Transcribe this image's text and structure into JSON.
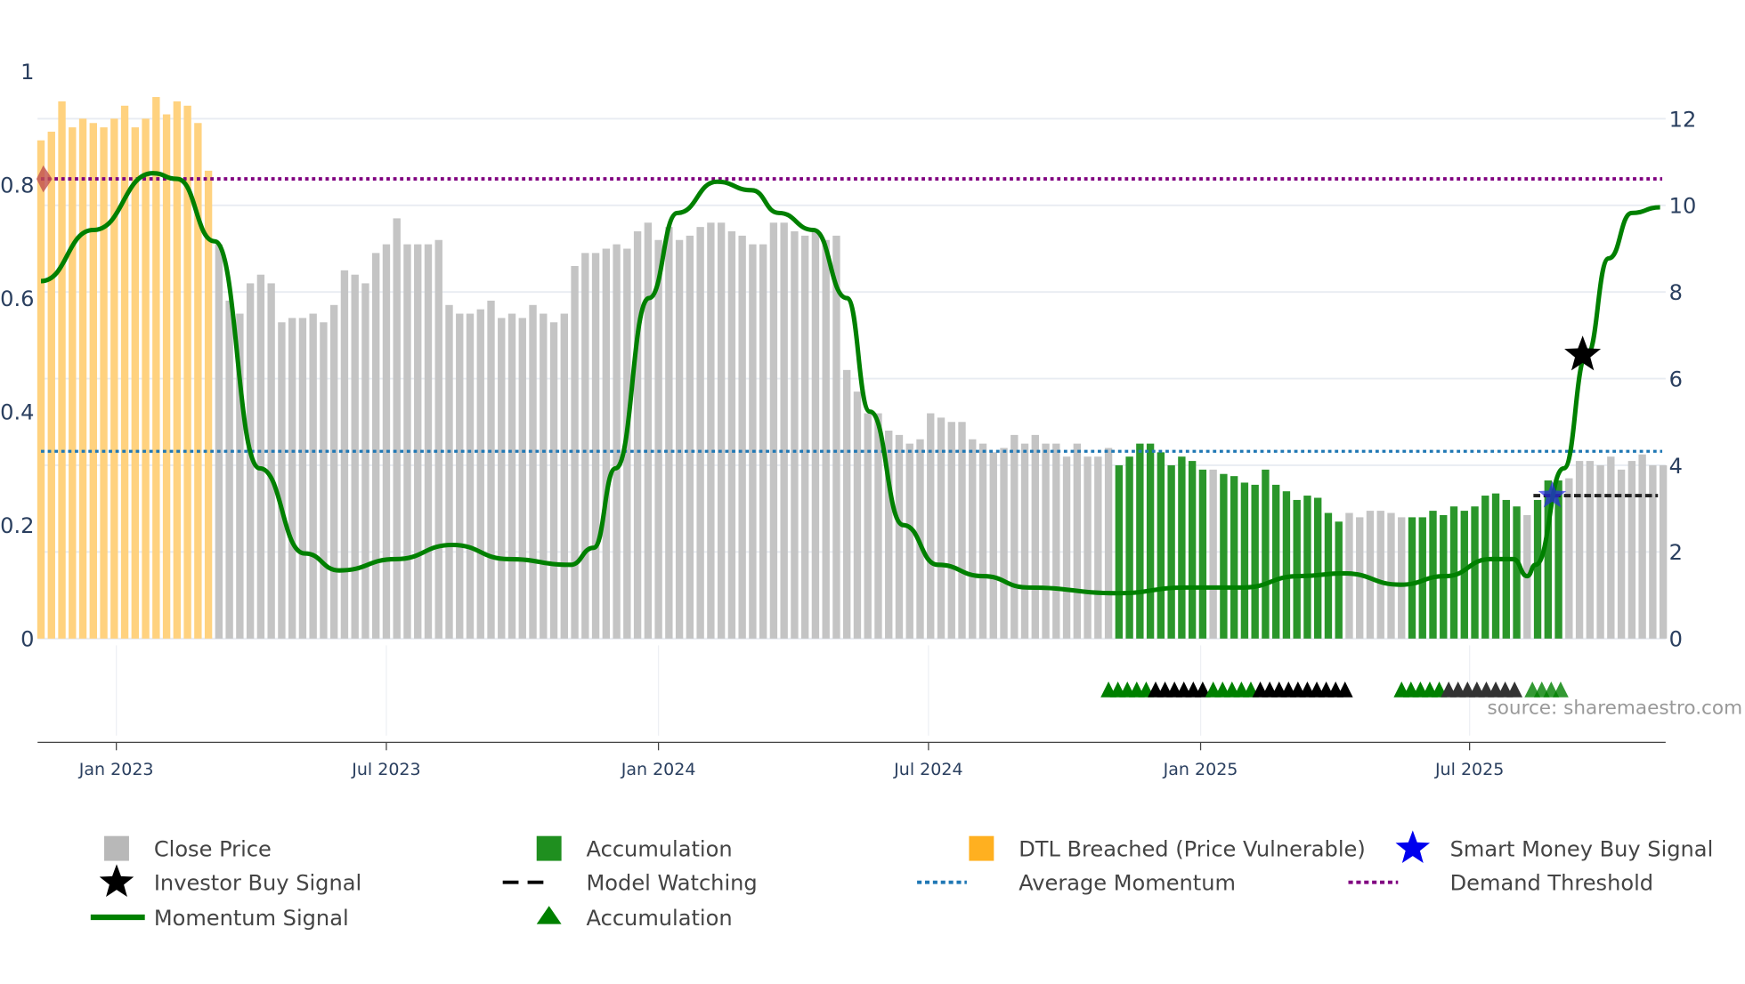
{
  "chart_data": {
    "type": "bar",
    "title": "",
    "x_unit": "week index (weekly bars)",
    "left_axis": {
      "ticks": [
        0,
        0.2,
        0.4,
        0.6,
        0.8,
        1
      ],
      "labels": [
        "0",
        "0.2",
        "0.4",
        "0.6",
        "0.8",
        "1"
      ],
      "range": [
        0,
        1
      ]
    },
    "right_axis": {
      "ticks": [
        0,
        2,
        4,
        6,
        8,
        10,
        12
      ],
      "labels": [
        "0",
        "2",
        "4",
        "6",
        "8",
        "10",
        "12"
      ],
      "range": [
        0,
        13.1
      ]
    },
    "x_ticks": [
      {
        "label": "Jan 2023",
        "x": 7.2
      },
      {
        "label": "Jul 2023",
        "x": 33.0
      },
      {
        "label": "Jan 2024",
        "x": 59.0
      },
      {
        "label": "Jul 2024",
        "x": 84.8
      },
      {
        "label": "Jan 2025",
        "x": 110.8
      },
      {
        "label": "Jul 2025",
        "x": 136.5
      }
    ],
    "close_price": [
      11.5,
      11.7,
      12.4,
      11.8,
      12.0,
      11.9,
      11.8,
      12.0,
      12.3,
      11.8,
      12.0,
      12.5,
      12.1,
      12.4,
      12.3,
      11.9,
      10.8,
      9.1,
      7.8,
      7.5,
      8.2,
      8.4,
      8.2,
      7.3,
      7.4,
      7.4,
      7.5,
      7.3,
      7.7,
      8.5,
      8.4,
      8.2,
      8.9,
      9.1,
      9.7,
      9.1,
      9.1,
      9.1,
      9.2,
      7.7,
      7.5,
      7.5,
      7.6,
      7.8,
      7.4,
      7.5,
      7.4,
      7.7,
      7.5,
      7.3,
      7.5,
      8.6,
      8.9,
      8.9,
      9.0,
      9.1,
      9.0,
      9.4,
      9.6,
      9.2,
      9.5,
      9.2,
      9.3,
      9.5,
      9.6,
      9.6,
      9.4,
      9.3,
      9.1,
      9.1,
      9.6,
      9.6,
      9.4,
      9.3,
      9.4,
      9.2,
      9.3,
      6.2,
      5.7,
      5.2,
      5.2,
      4.8,
      4.7,
      4.5,
      4.6,
      5.2,
      5.1,
      5.0,
      5.0,
      4.6,
      4.5,
      4.3,
      4.4,
      4.7,
      4.5,
      4.7,
      4.5,
      4.5,
      4.2,
      4.5,
      4.2,
      4.2,
      4.4,
      4.0,
      4.2,
      4.5,
      4.5,
      4.3,
      4.0,
      4.2,
      4.1,
      3.9,
      3.9,
      3.8,
      3.75,
      3.6,
      3.55,
      3.9,
      3.55,
      3.4,
      3.2,
      3.3,
      3.25,
      2.9,
      2.7,
      2.9,
      2.8,
      2.95,
      2.95,
      2.9,
      2.8,
      2.8,
      2.8,
      2.95,
      2.85,
      3.05,
      2.95,
      3.05,
      3.3,
      3.35,
      3.2,
      3.05,
      2.85,
      3.2,
      3.65,
      3.65,
      3.7,
      4.1,
      4.1,
      4.0,
      4.2,
      3.9,
      4.1,
      4.25,
      4.0,
      4.0
    ],
    "bar_category_ranges": [
      {
        "category": "dtl",
        "from": 0,
        "to": 16
      },
      {
        "category": "close",
        "from": 17,
        "to": 102
      },
      {
        "category": "accumulation",
        "from": 103,
        "to": 111
      },
      {
        "category": "close",
        "from": 112,
        "to": 112
      },
      {
        "category": "accumulation",
        "from": 113,
        "to": 124
      },
      {
        "category": "close",
        "from": 125,
        "to": 130
      },
      {
        "category": "accumulation",
        "from": 131,
        "to": 141
      },
      {
        "category": "close",
        "from": 142,
        "to": 142
      },
      {
        "category": "accumulation",
        "from": 143,
        "to": 145
      },
      {
        "category": "close",
        "from": 146,
        "to": 155
      }
    ],
    "momentum": [
      [
        0,
        0.63
      ],
      [
        5,
        0.72
      ],
      [
        10.7,
        0.82
      ],
      [
        13,
        0.81
      ],
      [
        16.6,
        0.7
      ],
      [
        20.9,
        0.3
      ],
      [
        25.2,
        0.15
      ],
      [
        28.5,
        0.12
      ],
      [
        33.9,
        0.14
      ],
      [
        39.3,
        0.165
      ],
      [
        44.7,
        0.14
      ],
      [
        50.6,
        0.13
      ],
      [
        52.8,
        0.16
      ],
      [
        54.9,
        0.3
      ],
      [
        58.1,
        0.6
      ],
      [
        60.8,
        0.75
      ],
      [
        64.6,
        0.805
      ],
      [
        67.9,
        0.79
      ],
      [
        70.5,
        0.75
      ],
      [
        73.8,
        0.72
      ],
      [
        77.0,
        0.6
      ],
      [
        79.2,
        0.4
      ],
      [
        82.4,
        0.2
      ],
      [
        85.7,
        0.13
      ],
      [
        90.0,
        0.11
      ],
      [
        94.3,
        0.09
      ],
      [
        102.9,
        0.08
      ],
      [
        109.4,
        0.09
      ],
      [
        114.8,
        0.09
      ],
      [
        120.2,
        0.11
      ],
      [
        124.5,
        0.115
      ],
      [
        129.9,
        0.095
      ],
      [
        134.2,
        0.11
      ],
      [
        138.5,
        0.14
      ],
      [
        140.7,
        0.14
      ],
      [
        142.0,
        0.11
      ],
      [
        142.8,
        0.13
      ],
      [
        145.5,
        0.3
      ],
      [
        147.7,
        0.5
      ],
      [
        149.8,
        0.67
      ],
      [
        152.0,
        0.75
      ],
      [
        154.7,
        0.76
      ]
    ],
    "average_momentum": 0.33,
    "demand_threshold": 0.81,
    "investor_buy_signal": {
      "x": 147.3,
      "momentum": 0.5
    },
    "smart_money_buy_signal": {
      "x": 144.4,
      "price": 3.3
    },
    "model_watching": {
      "from": 142.6,
      "to": 154.5,
      "price": 3.3
    },
    "signal_markers": [
      {
        "type": "accumulation",
        "from": 102,
        "to": 106
      },
      {
        "type": "watch",
        "from": 106.5,
        "to": 111
      },
      {
        "type": "accumulation",
        "from": 112,
        "to": 116
      },
      {
        "type": "watch",
        "from": 116.5,
        "to": 125
      },
      {
        "type": "accumulation",
        "from": 130,
        "to": 134
      },
      {
        "type": "watch-dim",
        "from": 134.5,
        "to": 141
      },
      {
        "type": "accumulation",
        "from": 142.5,
        "to": 145.5
      }
    ],
    "legend": [
      {
        "label": "Close Price",
        "symbol": "square",
        "color": "#b8b8b8"
      },
      {
        "label": "Accumulation",
        "symbol": "square",
        "color": "#1f8f1f"
      },
      {
        "label": "DTL Breached (Price Vulnerable)",
        "symbol": "square",
        "color": "#ffb020"
      },
      {
        "label": "Smart Money Buy Signal",
        "symbol": "star",
        "color": "#0000ee"
      },
      {
        "label": "Investor Buy Signal",
        "symbol": "star",
        "color": "#000000"
      },
      {
        "label": "Model Watching",
        "symbol": "dash",
        "color": "#000000"
      },
      {
        "label": "Average Momentum",
        "symbol": "dot",
        "color": "#1f77b4"
      },
      {
        "label": "Demand Threshold",
        "symbol": "dot",
        "color": "#800080"
      },
      {
        "label": "Momentum Signal",
        "symbol": "line",
        "color": "#008000"
      },
      {
        "label": "Accumulation",
        "symbol": "triangle",
        "color": "#008000"
      }
    ],
    "legend_placement": "bottom",
    "source": "source: sharemaestro.com"
  },
  "colors": {
    "close": "#c4c4c4",
    "accumulation": "#2a962a",
    "dtl": "#ffd27f",
    "momentum": "#008000",
    "avg": "#1f77b4",
    "threshold": "#800080"
  }
}
